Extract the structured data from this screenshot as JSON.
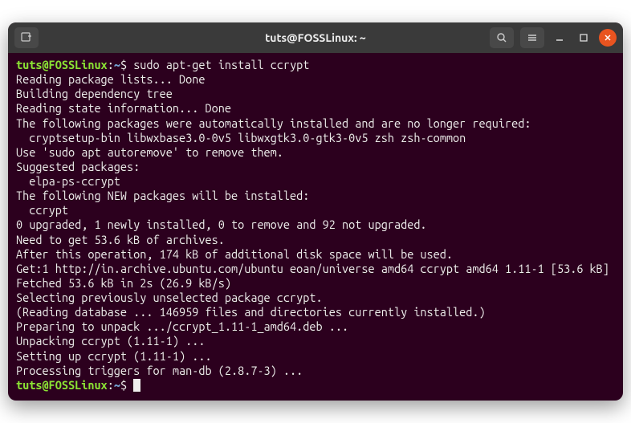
{
  "titlebar": {
    "title": "tuts@FOSSLinux: ~",
    "new_tab_icon": "new-tab",
    "search_icon": "search",
    "menu_icon": "menu",
    "minimize_icon": "minimize",
    "maximize_icon": "maximize",
    "close_icon": "close"
  },
  "prompt": {
    "user_host": "tuts@FOSSLinux",
    "colon": ":",
    "path": "~",
    "dollar": "$"
  },
  "command": "sudo apt-get install ccrypt",
  "output": [
    "Reading package lists... Done",
    "Building dependency tree",
    "Reading state information... Done",
    "The following packages were automatically installed and are no longer required:",
    "  cryptsetup-bin libwxbase3.0-0v5 libwxgtk3.0-gtk3-0v5 zsh zsh-common",
    "Use 'sudo apt autoremove' to remove them.",
    "Suggested packages:",
    "  elpa-ps-ccrypt",
    "The following NEW packages will be installed:",
    "  ccrypt",
    "0 upgraded, 1 newly installed, 0 to remove and 92 not upgraded.",
    "Need to get 53.6 kB of archives.",
    "After this operation, 174 kB of additional disk space will be used.",
    "Get:1 http://in.archive.ubuntu.com/ubuntu eoan/universe amd64 ccrypt amd64 1.11-1 [53.6 kB]",
    "Fetched 53.6 kB in 2s (26.9 kB/s)",
    "Selecting previously unselected package ccrypt.",
    "(Reading database ... 146959 files and directories currently installed.)",
    "Preparing to unpack .../ccrypt_1.11-1_amd64.deb ...",
    "Unpacking ccrypt (1.11-1) ...",
    "Setting up ccrypt (1.11-1) ...",
    "Processing triggers for man-db (2.8.7-3) ..."
  ]
}
